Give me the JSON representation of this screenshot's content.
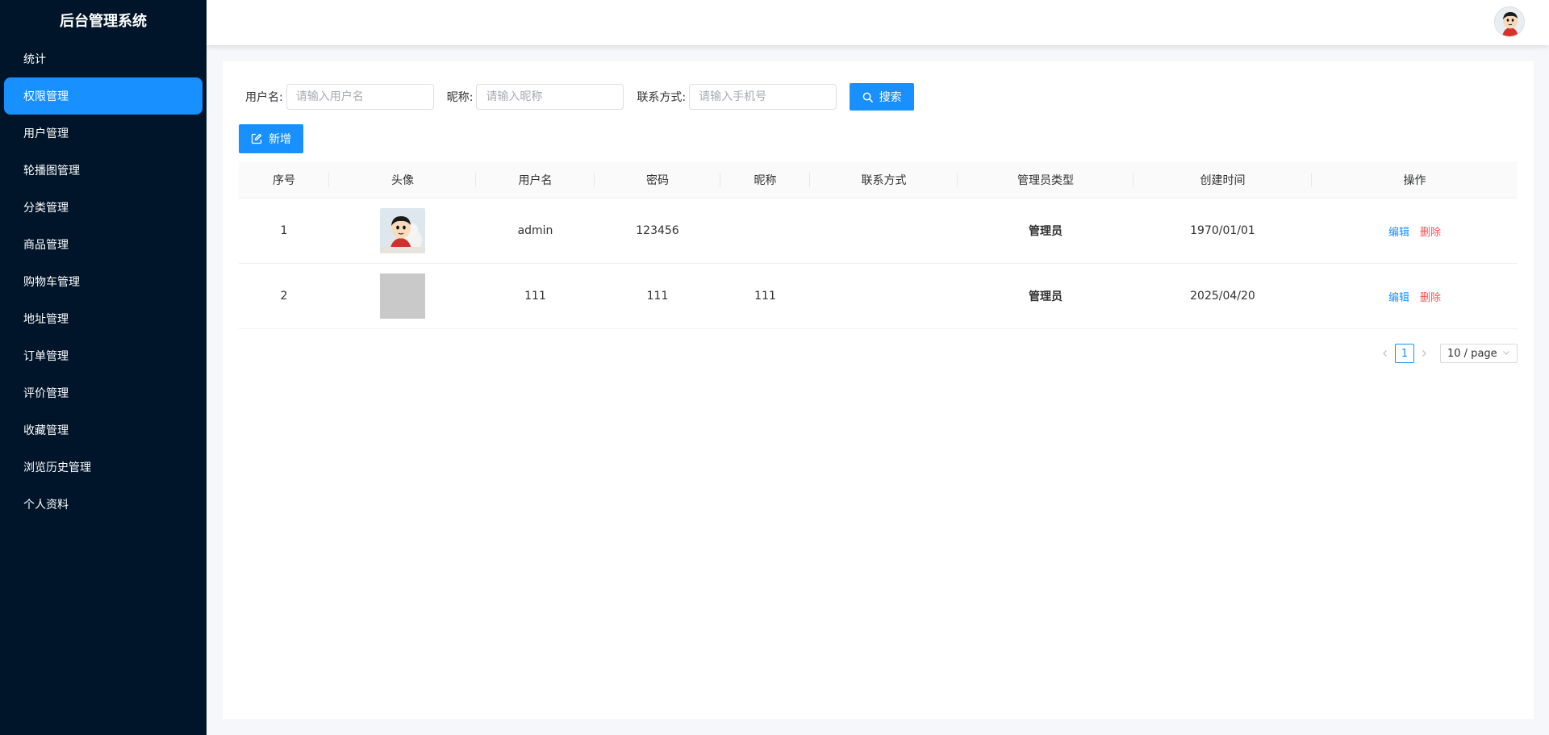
{
  "app": {
    "title": "后台管理系统"
  },
  "sidebar": {
    "items": [
      {
        "label": "统计",
        "active": false
      },
      {
        "label": "权限管理",
        "active": true
      },
      {
        "label": "用户管理",
        "active": false
      },
      {
        "label": "轮播图管理",
        "active": false
      },
      {
        "label": "分类管理",
        "active": false
      },
      {
        "label": "商品管理",
        "active": false
      },
      {
        "label": "购物车管理",
        "active": false
      },
      {
        "label": "地址管理",
        "active": false
      },
      {
        "label": "订单管理",
        "active": false
      },
      {
        "label": "评价管理",
        "active": false
      },
      {
        "label": "收藏管理",
        "active": false
      },
      {
        "label": "浏览历史管理",
        "active": false
      },
      {
        "label": "个人资料",
        "active": false
      }
    ]
  },
  "search": {
    "username_label": "用户名:",
    "username_placeholder": "请输入用户名",
    "nickname_label": "昵称:",
    "nickname_placeholder": "请输入昵称",
    "contact_label": "联系方式:",
    "contact_placeholder": "请输入手机号",
    "search_button": "搜索"
  },
  "toolbar": {
    "add_button": "新增"
  },
  "table": {
    "columns": [
      "序号",
      "头像",
      "用户名",
      "密码",
      "昵称",
      "联系方式",
      "管理员类型",
      "创建时间",
      "操作"
    ],
    "rows": [
      {
        "index": "1",
        "avatar": "cartoon-avatar",
        "username": "admin",
        "password": "123456",
        "nickname": "",
        "contact": "",
        "admin_type": "管理员",
        "created": "1970/01/01",
        "edit": "编辑",
        "delete": "删除"
      },
      {
        "index": "2",
        "avatar": "placeholder",
        "username": "111",
        "password": "111",
        "nickname": "111",
        "contact": "",
        "admin_type": "管理员",
        "created": "2025/04/20",
        "edit": "编辑",
        "delete": "删除"
      }
    ]
  },
  "pagination": {
    "current_page": "1",
    "page_size": "10 / page"
  },
  "colors": {
    "sidebar_bg": "#001529",
    "accent": "#1890ff",
    "danger": "#ff4d4f"
  },
  "icons": {
    "search": "search-icon",
    "add": "edit-square-icon",
    "prev": "chevron-left-icon",
    "next": "chevron-right-icon",
    "dropdown": "chevron-down-icon"
  }
}
